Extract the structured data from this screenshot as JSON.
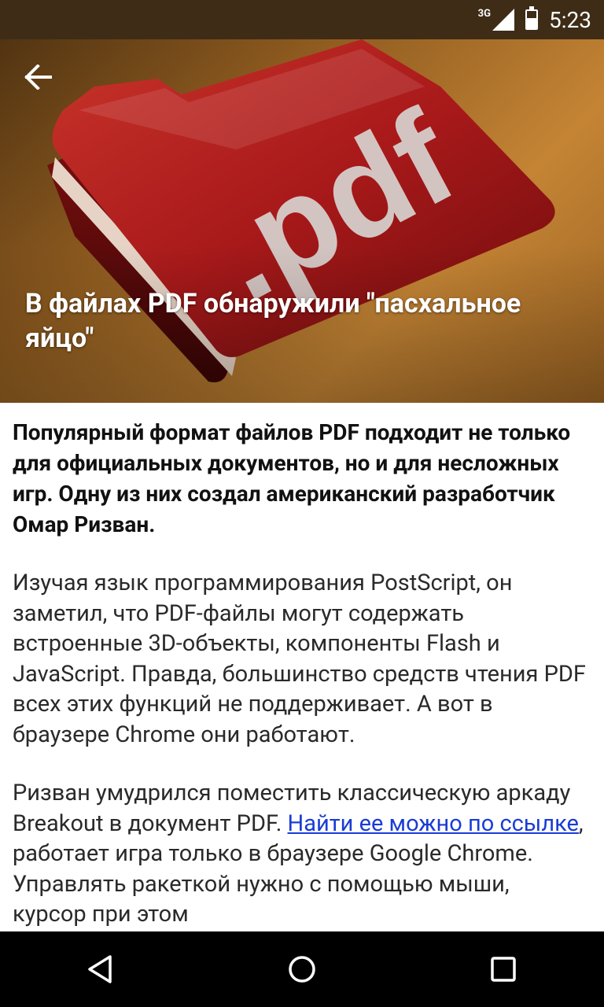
{
  "status_bar": {
    "network": "3G",
    "time": "5:23"
  },
  "hero": {
    "title": "В файлах PDF обнаружили \"пасхальное яйцо\"",
    "image_text": ".pdf"
  },
  "article": {
    "lead": "Популярный формат файлов PDF подходит не только для официальных документов, но и для несложных игр. Одну из них создал американский разработчик Омар Ризван.",
    "paragraph_1": "Изучая язык программирования PostScript, он заметил, что PDF-файлы могут содержать встроенные 3D-объекты, компоненты Flash и JavaScript. Правда, большинство средств чтения PDF всех этих функций не поддерживает. А вот в браузере Chrome они работают.",
    "paragraph_2_start": "Ризван умудрился поместить классическую аркаду Breakout в документ PDF. ",
    "paragraph_2_link": "Найти ее можно по ссылке",
    "paragraph_2_end": ", работает игра только в браузере Google Chrome. Управлять ракеткой нужно с помощью мыши, курсор при этом"
  },
  "colors": {
    "status_bar": "#3e2c17",
    "link": "#1a3cd6",
    "folder_red": "#b0201c",
    "nav_bar": "#000000"
  },
  "icons": {
    "back": "arrow-left",
    "nav_back": "triangle-left",
    "nav_home": "circle",
    "nav_recents": "square"
  }
}
